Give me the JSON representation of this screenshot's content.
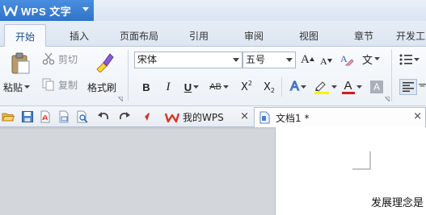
{
  "app": {
    "name": "WPS 文字"
  },
  "tabs": [
    {
      "label": "开始",
      "active": true
    },
    {
      "label": "插入"
    },
    {
      "label": "页面布局"
    },
    {
      "label": "引用"
    },
    {
      "label": "审阅"
    },
    {
      "label": "视图"
    },
    {
      "label": "章节"
    },
    {
      "label": "开发工"
    }
  ],
  "ribbon": {
    "paste": "粘贴",
    "cut": "剪切",
    "copy": "复制",
    "format_painter": "格式刷",
    "font_name": "宋体",
    "font_size": "五号",
    "bold": "B",
    "italic": "I",
    "underline": "U",
    "strikethrough": "AB",
    "superscript": "X",
    "sup_mark": "2",
    "subscript": "X",
    "sub_mark": "2",
    "grow_font": "A",
    "shrink_font": "A",
    "text_effect": "A",
    "font_color": "A",
    "char_shading": "A",
    "phonetic": "文"
  },
  "quick_access": {
    "tabs": [
      {
        "label": "我的WPS",
        "close": "×"
      },
      {
        "label": "文档1 *",
        "close": "×"
      }
    ]
  },
  "document": {
    "visible_text": "发展理念是"
  },
  "colors": {
    "app_button": "#2f73c9",
    "wps_red": "#d9342b",
    "font_color_bar": "#d21d1d",
    "highlight_bar": "#ffef00"
  }
}
